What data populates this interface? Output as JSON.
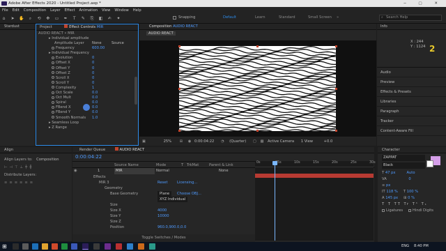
{
  "window": {
    "title": "Adobe After Effects 2020 - Untitled Project.aep *"
  },
  "menu": [
    "File",
    "Edit",
    "Composition",
    "Layer",
    "Effect",
    "Animation",
    "View",
    "Window",
    "Help"
  ],
  "toolbar": {
    "snapping_label": "Snapping"
  },
  "workspaces": [
    "Default",
    "Learn",
    "Standard",
    "Small Screen"
  ],
  "search_placeholder": "Search Help",
  "left_tabs": {
    "stardust": "Stardust",
    "project": "Project",
    "effect_controls": "Effect Controls",
    "effect_controls_target": "MIR"
  },
  "effect_controls": {
    "breadcrumb": "AUDIO REACT • MIR",
    "rows": [
      {
        "label": "Individual amplitude",
        "value": "",
        "kind": "group"
      },
      {
        "label": "Amplitude Layer",
        "value": "None",
        "value2": "Source",
        "kind": "dropdown"
      },
      {
        "label": "Frequency",
        "value": "600.00",
        "kind": "param"
      },
      {
        "label": "Individual Frequency",
        "value": "",
        "kind": "group"
      },
      {
        "label": "Evolution",
        "value": "0",
        "kind": "param"
      },
      {
        "label": "Offset X",
        "value": "0",
        "kind": "param"
      },
      {
        "label": "Offset Y",
        "value": "0",
        "kind": "param"
      },
      {
        "label": "Offset Z",
        "value": "0",
        "kind": "param"
      },
      {
        "label": "Scroll X",
        "value": "0",
        "kind": "param"
      },
      {
        "label": "Scroll Y",
        "value": "0",
        "kind": "param"
      },
      {
        "label": "Complexity",
        "value": "1",
        "kind": "param"
      },
      {
        "label": "Oct Scale",
        "value": "0.0",
        "kind": "param"
      },
      {
        "label": "Oct Mult",
        "value": "0.0",
        "kind": "param"
      },
      {
        "label": "Spiral",
        "value": "0.0",
        "kind": "param"
      },
      {
        "label": "FBend X",
        "value": "0.0",
        "kind": "param"
      },
      {
        "label": "FBend Y",
        "value": "0.0",
        "kind": "param"
      },
      {
        "label": "Smooth Normals",
        "value": "1.0",
        "kind": "param"
      },
      {
        "label": "Seamless Loop",
        "value": "",
        "kind": "group"
      },
      {
        "label": "Z Range",
        "value": "",
        "kind": "group"
      }
    ]
  },
  "composition": {
    "tab_label": "Composition",
    "tab_name": "AUDIO REACT",
    "subtab": "AUDIO REACT"
  },
  "viewer": {
    "zoom": "25%",
    "timecode": "0:00:04:22",
    "resolution": "(Quarter)",
    "camera": "Active Camera",
    "views": "1 View",
    "exposure": "+0.0"
  },
  "info_panel": {
    "title": "Info",
    "x_readout": "X : 244",
    "y_readout": "Y : 1124"
  },
  "right_panels": [
    "Audio",
    "Preview",
    "Effects & Presets",
    "Libraries",
    "Paragraph",
    "Tracker",
    "Content-Aware Fill"
  ],
  "align_panel": {
    "title": "Align",
    "align_to_label": "Align Layers to:",
    "align_to_value": "Composition",
    "distribute_label": "Distribute Layers:"
  },
  "timeline": {
    "render_queue_tab": "Render Queue",
    "comp_tab": "AUDIO REACT",
    "timecode": "0:00:04:22",
    "columns": {
      "source": "Source Name",
      "mode": "Mode",
      "t": "T",
      "trkmat": "TrkMat",
      "parent": "Parent & Link"
    },
    "layer": {
      "index": "1",
      "name": "MIR",
      "mode": "Normal",
      "parent": "None"
    },
    "rows": [
      {
        "indent": 1,
        "label": "Effects",
        "value": ""
      },
      {
        "indent": 2,
        "label": "MIR 3",
        "value": "Reset",
        "value2": "Licensing..."
      },
      {
        "indent": 3,
        "label": "Geometry",
        "value": ""
      },
      {
        "indent": 4,
        "label": "Base Geometry",
        "value": "Plane",
        "value2": "Choose OBJ..."
      },
      {
        "indent": 4,
        "label": "",
        "value": "XYZ Individual"
      },
      {
        "indent": 4,
        "label": "Size",
        "value": ""
      },
      {
        "indent": 4,
        "label": "Size X",
        "value": "4000"
      },
      {
        "indent": 4,
        "label": "Size Y",
        "value": "10000"
      },
      {
        "indent": 4,
        "label": "Size Z",
        "value": ""
      },
      {
        "indent": 4,
        "label": "Position",
        "value": "960.0,900.0,0.0"
      }
    ],
    "ruler": [
      "0s",
      "05s",
      "10s",
      "15s",
      "20s",
      "25s",
      "30s"
    ],
    "footer": "Toggle Switches / Modes"
  },
  "character_panel": {
    "title": "Character",
    "font": "ZAPPAT",
    "style": "Black",
    "size": "47 px",
    "leading": "Auto",
    "tracking": "0",
    "unit": "px",
    "vscale": "118 %",
    "hscale": "100 %",
    "baseline": "145 px",
    "tsume": "0 %",
    "ligatures": "Ligatures",
    "hindi": "Hindi Digits"
  },
  "taskbar": {
    "lang": "ENG",
    "time": "8:40 PM"
  },
  "colors": {
    "accent": "#2d8ceb",
    "layer_red": "#b73a32",
    "label_blue": "#4f9bff",
    "playhead": "#7ab7ff"
  }
}
